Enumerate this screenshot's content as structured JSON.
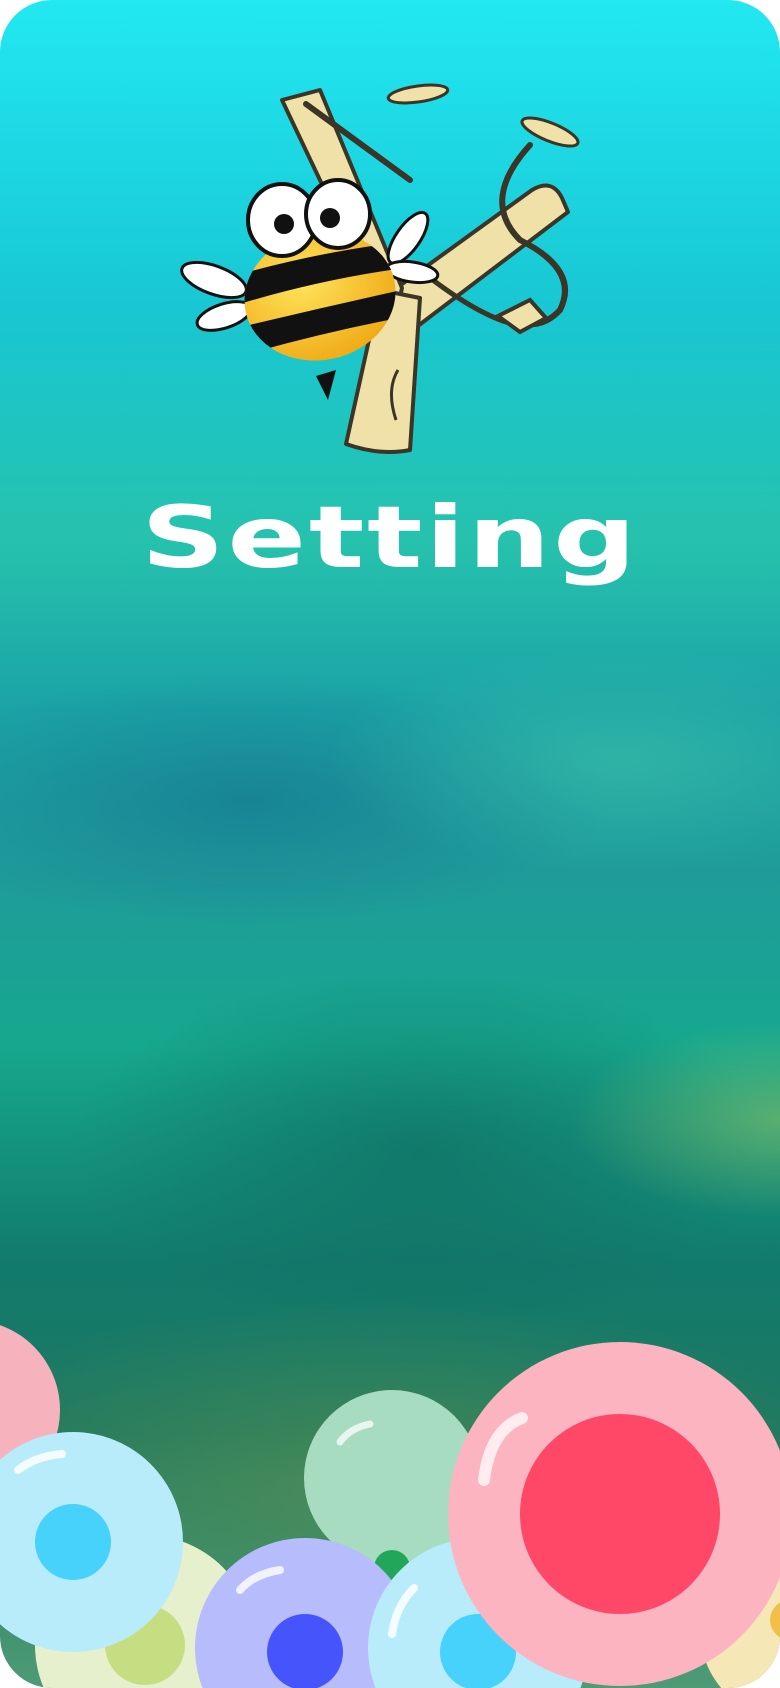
{
  "screen": {
    "title": "Setting",
    "logo": {
      "icon": "bee-slingshot-icon",
      "bee_colors": {
        "body": "#f5c518",
        "stripe": "#111111",
        "wing": "#ffffff"
      },
      "slingshot_color": "#efe1a8"
    }
  },
  "bubbles": [
    {
      "name": "bubble-pink-left-edge",
      "outer": "#f6b3bd",
      "inner": "#ff4466"
    },
    {
      "name": "bubble-light-blue-left",
      "outer": "#b8ecfb",
      "inner": "#46d2fb"
    },
    {
      "name": "bubble-cream-left",
      "outer": "#e6f0cc",
      "inner": "#c6de82"
    },
    {
      "name": "bubble-green-center",
      "outer": "#a8dcc0",
      "inner": "#21a65a"
    },
    {
      "name": "bubble-purple-center",
      "outer": "#b7bcfc",
      "inner": "#4655fb"
    },
    {
      "name": "bubble-light-blue-center",
      "outer": "#b8ecfb",
      "inner": "#46d2fb"
    },
    {
      "name": "bubble-pink-large-right",
      "outer": "#fbb4c0",
      "inner": "#ff4768"
    },
    {
      "name": "bubble-yellow-right-edge",
      "outer": "#f6e8b6",
      "inner": "#f0c04a"
    }
  ]
}
